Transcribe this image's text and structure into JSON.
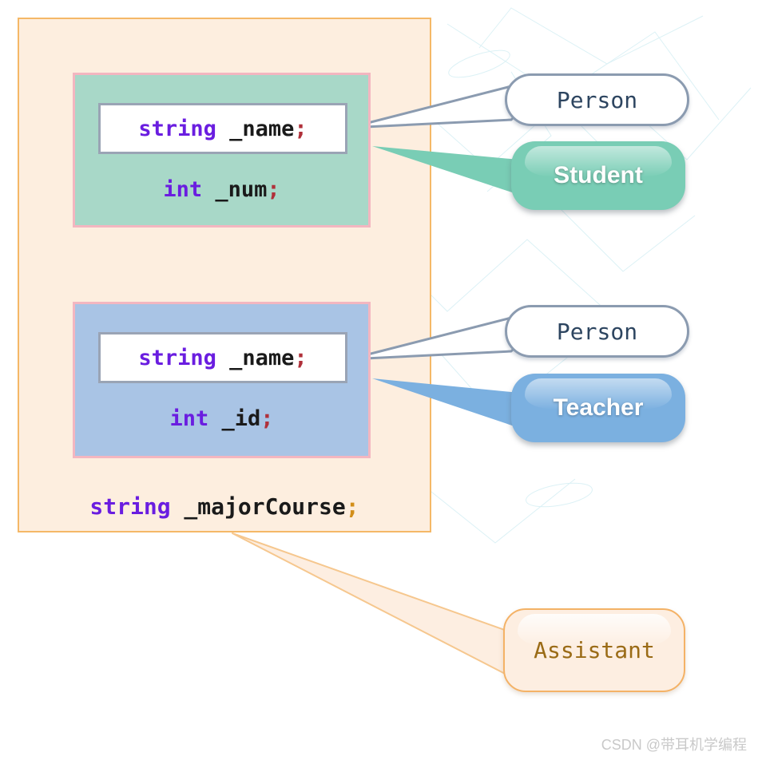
{
  "diagram": {
    "title": "C++ inheritance member layout diagram",
    "outer_container": {
      "name": "Assistant class member layout",
      "fill_color": "#fdeedf",
      "border_color": "#f5b867"
    },
    "member_boxes": [
      {
        "id": "student",
        "fill_color": "#a8d8c8",
        "border_color": "#f3b6c0",
        "inherited_field": {
          "keyword": "string",
          "identifier": " _name",
          "terminator": ";"
        },
        "own_field": {
          "keyword": "int",
          "identifier": " _num",
          "terminator": ";"
        }
      },
      {
        "id": "teacher",
        "fill_color": "#a9c4e5",
        "border_color": "#f3b6c0",
        "inherited_field": {
          "keyword": "string",
          "identifier": " _name",
          "terminator": ";"
        },
        "own_field": {
          "keyword": "int",
          "identifier": " _id",
          "terminator": ";"
        }
      }
    ],
    "major_course_field": {
      "keyword": "string",
      "identifier": " _majorCourse",
      "terminator": ";"
    },
    "callouts": [
      {
        "id": "person-student",
        "label": "Person",
        "style": "white-rounded",
        "text_color": "#2d4560"
      },
      {
        "id": "person-teacher",
        "label": "Person",
        "style": "white-rounded",
        "text_color": "#2d4560"
      }
    ],
    "class_badges": [
      {
        "id": "student",
        "label": "Student",
        "color": "#79cdb5"
      },
      {
        "id": "teacher",
        "label": "Teacher",
        "color": "#7bb0e0"
      },
      {
        "id": "assistant",
        "label": "Assistant",
        "color": "#fdeee1",
        "text_color": "#9a6b16"
      }
    ],
    "watermark": "CSDN @带耳机学编程"
  }
}
